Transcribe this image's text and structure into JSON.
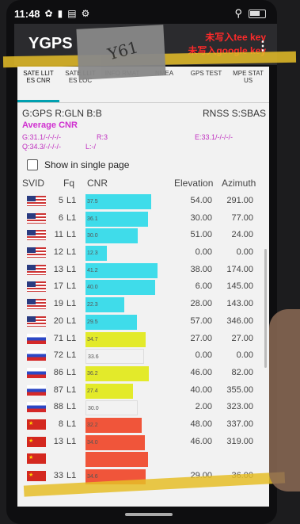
{
  "status": {
    "time": "11:48"
  },
  "app": {
    "title": "YGPS",
    "warning_line1": "未写入tee key",
    "warning_line2": "未写入google key"
  },
  "tabs": [
    {
      "label": "SATE LLIT ES CNR",
      "active": true
    },
    {
      "label": "SATE LLIT ES LOC",
      "active": false
    },
    {
      "label": "INFO RMAT",
      "active": false
    },
    {
      "label": "NMEA",
      "active": false
    },
    {
      "label": "GPS TEST",
      "active": false
    },
    {
      "label": "MPE STAT US",
      "active": false
    }
  ],
  "constellations": {
    "head": "G:GPS R:GLN B:B",
    "tail": "RNSS S:SBAS"
  },
  "average": {
    "title": "Average CNR",
    "g": "G:31.1/-/-/-/-",
    "r": "R:3",
    "e": "E:33.1/-/-/-/-",
    "q": "Q:34.3/-/-/-/-",
    "l": "L:-/"
  },
  "show_single_page": "Show in single page",
  "table": {
    "headers": {
      "svid": "SVID",
      "fq": "Fq",
      "cnr": "CNR",
      "elevation": "Elevation",
      "azimuth": "Azimuth"
    },
    "rows": [
      {
        "flag": "us",
        "svid": "5",
        "fq": "L1",
        "cnr": 37.5,
        "cnr_label": "37.5",
        "color": "#3fdcea",
        "elevation": "54.00",
        "azimuth": "291.00"
      },
      {
        "flag": "us",
        "svid": "6",
        "fq": "L1",
        "cnr": 36.1,
        "cnr_label": "36.1",
        "color": "#3fdcea",
        "elevation": "30.00",
        "azimuth": "77.00"
      },
      {
        "flag": "us",
        "svid": "11",
        "fq": "L1",
        "cnr": 30.0,
        "cnr_label": "30.0",
        "color": "#3fdcea",
        "elevation": "51.00",
        "azimuth": "24.00"
      },
      {
        "flag": "us",
        "svid": "12",
        "fq": "L1",
        "cnr": 12.3,
        "cnr_label": "12.3",
        "color": "#3fdcea",
        "elevation": "0.00",
        "azimuth": "0.00"
      },
      {
        "flag": "us",
        "svid": "13",
        "fq": "L1",
        "cnr": 41.2,
        "cnr_label": "41.2",
        "color": "#3fdcea",
        "elevation": "38.00",
        "azimuth": "174.00"
      },
      {
        "flag": "us",
        "svid": "17",
        "fq": "L1",
        "cnr": 40.0,
        "cnr_label": "40.0",
        "color": "#3fdcea",
        "elevation": "6.00",
        "azimuth": "145.00"
      },
      {
        "flag": "us",
        "svid": "19",
        "fq": "L1",
        "cnr": 22.3,
        "cnr_label": "22.3",
        "color": "#3fdcea",
        "elevation": "28.00",
        "azimuth": "143.00"
      },
      {
        "flag": "us",
        "svid": "20",
        "fq": "L1",
        "cnr": 29.5,
        "cnr_label": "29.5",
        "color": "#3fdcea",
        "elevation": "57.00",
        "azimuth": "346.00"
      },
      {
        "flag": "ru",
        "svid": "71",
        "fq": "L1",
        "cnr": 34.7,
        "cnr_label": "34.7",
        "color": "#e3ea2a",
        "elevation": "27.00",
        "azimuth": "27.00"
      },
      {
        "flag": "ru",
        "svid": "72",
        "fq": "L1",
        "cnr": 33.6,
        "cnr_label": "33.6",
        "color": "#f2f2f2",
        "elevation": "0.00",
        "azimuth": "0.00"
      },
      {
        "flag": "ru",
        "svid": "86",
        "fq": "L1",
        "cnr": 36.2,
        "cnr_label": "36.2",
        "color": "#e3ea2a",
        "elevation": "46.00",
        "azimuth": "82.00"
      },
      {
        "flag": "ru",
        "svid": "87",
        "fq": "L1",
        "cnr": 27.4,
        "cnr_label": "27.4",
        "color": "#e3ea2a",
        "elevation": "40.00",
        "azimuth": "355.00"
      },
      {
        "flag": "ru",
        "svid": "88",
        "fq": "L1",
        "cnr": 30.0,
        "cnr_label": "30.0",
        "color": "#f2f2f2",
        "elevation": "2.00",
        "azimuth": "323.00"
      },
      {
        "flag": "cn",
        "svid": "8",
        "fq": "L1",
        "cnr": 32.2,
        "cnr_label": "32.2",
        "color": "#f0553a",
        "elevation": "48.00",
        "azimuth": "337.00"
      },
      {
        "flag": "cn",
        "svid": "13",
        "fq": "L1",
        "cnr": 34.0,
        "cnr_label": "34.0",
        "color": "#f0553a",
        "elevation": "46.00",
        "azimuth": "319.00"
      },
      {
        "flag": "cn",
        "svid": "",
        "fq": "",
        "cnr": 36.0,
        "cnr_label": "",
        "color": "#f0553a",
        "elevation": "",
        "azimuth": ""
      },
      {
        "flag": "cn",
        "svid": "33",
        "fq": "L1",
        "cnr": 34.6,
        "cnr_label": "34.6",
        "color": "#f0553a",
        "elevation": "29.00",
        "azimuth": "36.00"
      }
    ]
  },
  "cnr_max": 50,
  "handwriting": "Y61"
}
